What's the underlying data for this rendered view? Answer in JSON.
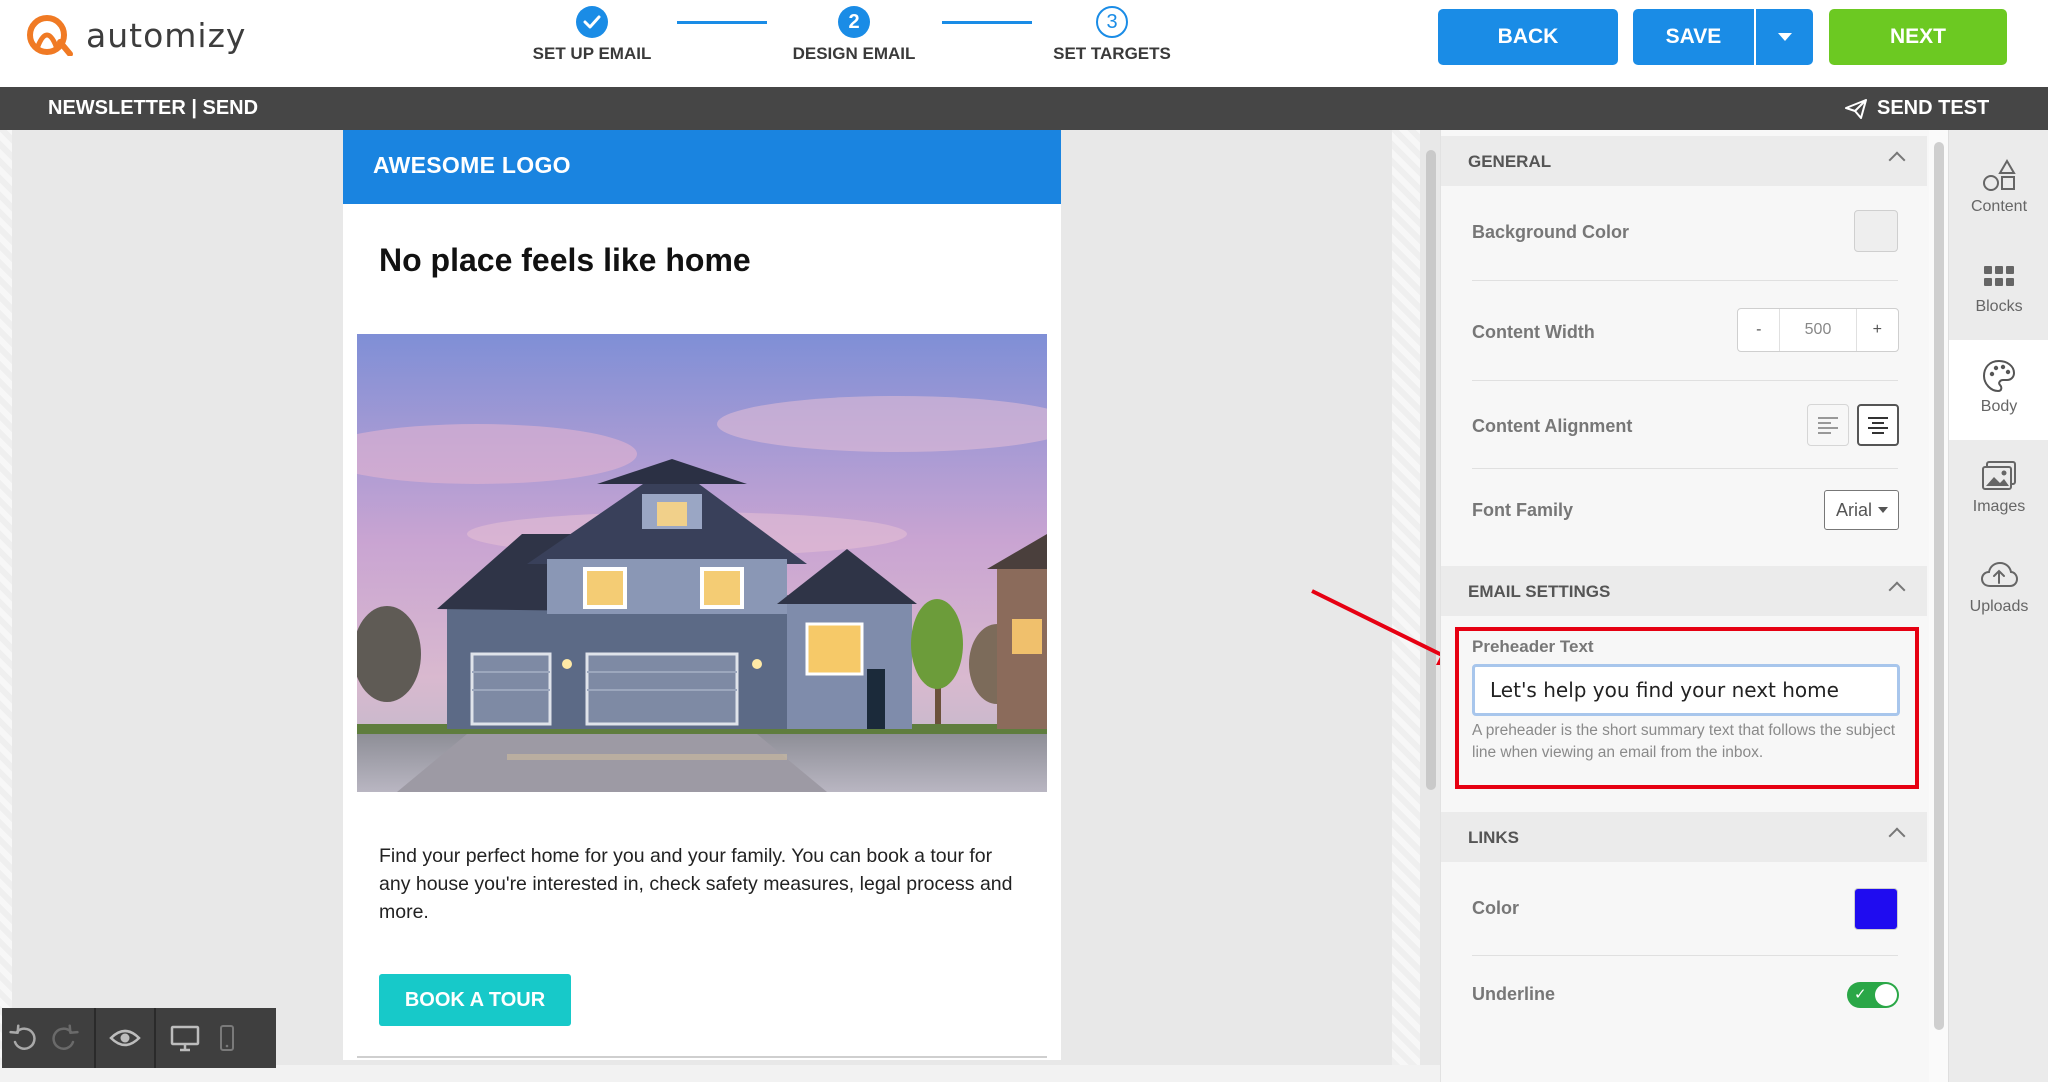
{
  "app": {
    "brand_name": "automizy",
    "accent_color": "#1a8ce6",
    "next_color": "#6cc922"
  },
  "wizard": {
    "steps": [
      {
        "number": "1",
        "label": "SET UP EMAIL",
        "state": "done"
      },
      {
        "number": "2",
        "label": "DESIGN EMAIL",
        "state": "active"
      },
      {
        "number": "3",
        "label": "SET TARGETS",
        "state": "todo"
      }
    ]
  },
  "actions": {
    "back_label": "BACK",
    "save_label": "SAVE",
    "next_label": "NEXT"
  },
  "subheader": {
    "title": "NEWSLETTER | SEND",
    "send_test_label": "SEND TEST"
  },
  "email": {
    "logo_text": "AWESOME LOGO",
    "headline": "No place feels like home",
    "body_text": "Find your perfect home for you and your family. You can book a tour for any house you're interested in, check safety measures, legal process and more.",
    "cta_label": "BOOK A TOUR",
    "header_color": "#1a84e0",
    "cta_color": "#17c9c9"
  },
  "panel": {
    "general": {
      "title": "GENERAL",
      "background_color_label": "Background Color",
      "background_color_value": "#eeeeee",
      "content_width_label": "Content Width",
      "content_width_minus": "-",
      "content_width_value": "500",
      "content_width_plus": "+",
      "content_alignment_label": "Content Alignment",
      "content_alignment_selected": "center",
      "font_family_label": "Font Family",
      "font_family_value": "Arial"
    },
    "email_settings": {
      "title": "EMAIL SETTINGS",
      "preheader_label": "Preheader Text",
      "preheader_value": "Let's help you find your next home",
      "preheader_help": "A preheader is the short summary text that follows the subject line when viewing an email from the inbox."
    },
    "links": {
      "title": "LINKS",
      "color_label": "Color",
      "color_value": "#1f0cf0",
      "underline_label": "Underline",
      "underline_on": true
    }
  },
  "rail": {
    "items": [
      {
        "label": "Content",
        "icon": "shapes-icon"
      },
      {
        "label": "Blocks",
        "icon": "grid-icon"
      },
      {
        "label": "Body",
        "icon": "palette-icon",
        "active": true
      },
      {
        "label": "Images",
        "icon": "images-icon"
      },
      {
        "label": "Uploads",
        "icon": "cloud-upload-icon"
      }
    ]
  },
  "annotation": {
    "highlight_color": "#e60012"
  }
}
